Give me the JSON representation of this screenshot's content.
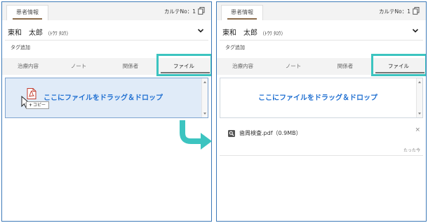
{
  "colors": {
    "accent": "#1f6fd1",
    "highlight": "#3cc4c0",
    "panel_border": "#3d7ab8",
    "drop_active_bg": "#e0ebf8"
  },
  "left": {
    "header": {
      "tab_label": "患者情報",
      "karte_label": "カルテNo：1"
    },
    "patient": {
      "name": "東和　太郎",
      "kana": "（ﾄｳﾜ ﾀﾛｳ）",
      "tag_add": "タグ追加"
    },
    "tabs": [
      "治療内容",
      "ノート",
      "関係者",
      "ファイル"
    ],
    "dropzone": {
      "text": "ここにファイルをドラッグ＆ドロップ"
    },
    "drag": {
      "badge_plus": "+",
      "badge_text": "コピー",
      "icons": [
        "pdf-file-icon",
        "mouse-cursor-icon"
      ]
    }
  },
  "right": {
    "header": {
      "tab_label": "患者情報",
      "karte_label": "カルテNo：1"
    },
    "patient": {
      "name": "東和　太郎",
      "kana": "（ﾄｳﾜ ﾀﾛｳ）",
      "tag_add": "タグ追加"
    },
    "tabs": [
      "治療内容",
      "ノート",
      "関係者",
      "ファイル"
    ],
    "dropzone": {
      "text": "ここにファイルをドラッグ＆ドロップ"
    },
    "file": {
      "name": "歯周検査.pdf（0.9MB）",
      "close": "×",
      "time": "たった今"
    }
  }
}
